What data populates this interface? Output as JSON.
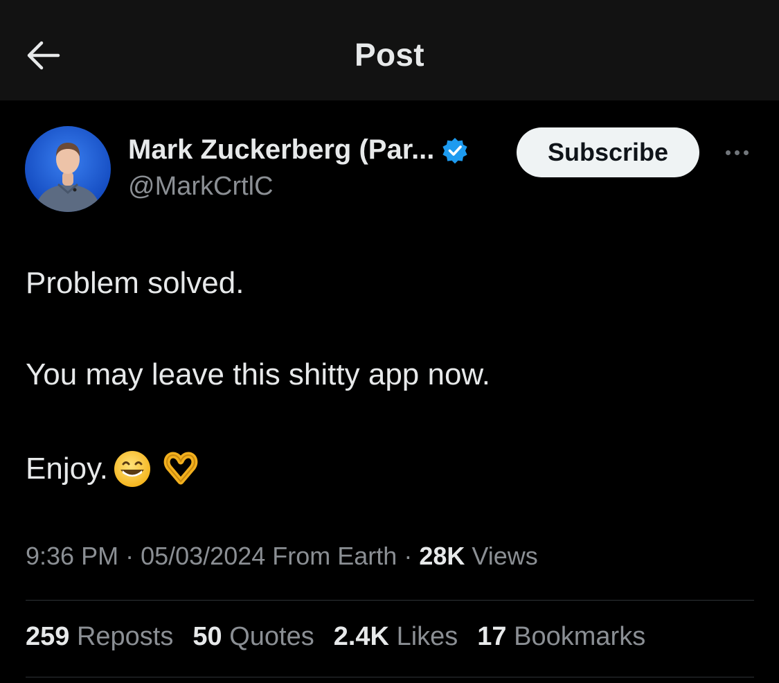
{
  "header": {
    "title": "Post",
    "back_icon": "arrow-left-icon"
  },
  "author": {
    "name": "Mark Zuckerberg (Par...",
    "handle": "@MarkCrtlC",
    "verified_icon": "verified-badge-icon",
    "verified_color": "#1d9bf0"
  },
  "actions": {
    "subscribe_label": "Subscribe",
    "more_icon": "more-horizontal-icon"
  },
  "post": {
    "line1": "Problem solved.",
    "line2": "You may leave this shitty app now.",
    "line3": "Enjoy.",
    "emojis": [
      "grinning-face-emoji",
      "heart-hands-emoji"
    ]
  },
  "meta": {
    "time": "9:36 PM",
    "sep1": " · ",
    "date": "05/03/2024",
    "source": " From Earth",
    "sep2": " · ",
    "views_count": "28K",
    "views_label": " Views"
  },
  "stats": {
    "reposts_count": "259",
    "reposts_label": " Reposts",
    "quotes_count": "50",
    "quotes_label": " Quotes",
    "likes_count": "2.4K",
    "likes_label": " Likes",
    "bookmarks_count": "17",
    "bookmarks_label": " Bookmarks"
  },
  "colors": {
    "background": "#000000",
    "header_bg": "#121212",
    "text_primary": "#e7e9ea",
    "text_secondary": "#8b8f94",
    "divider": "#2f3336",
    "button_bg": "#eff3f4"
  }
}
